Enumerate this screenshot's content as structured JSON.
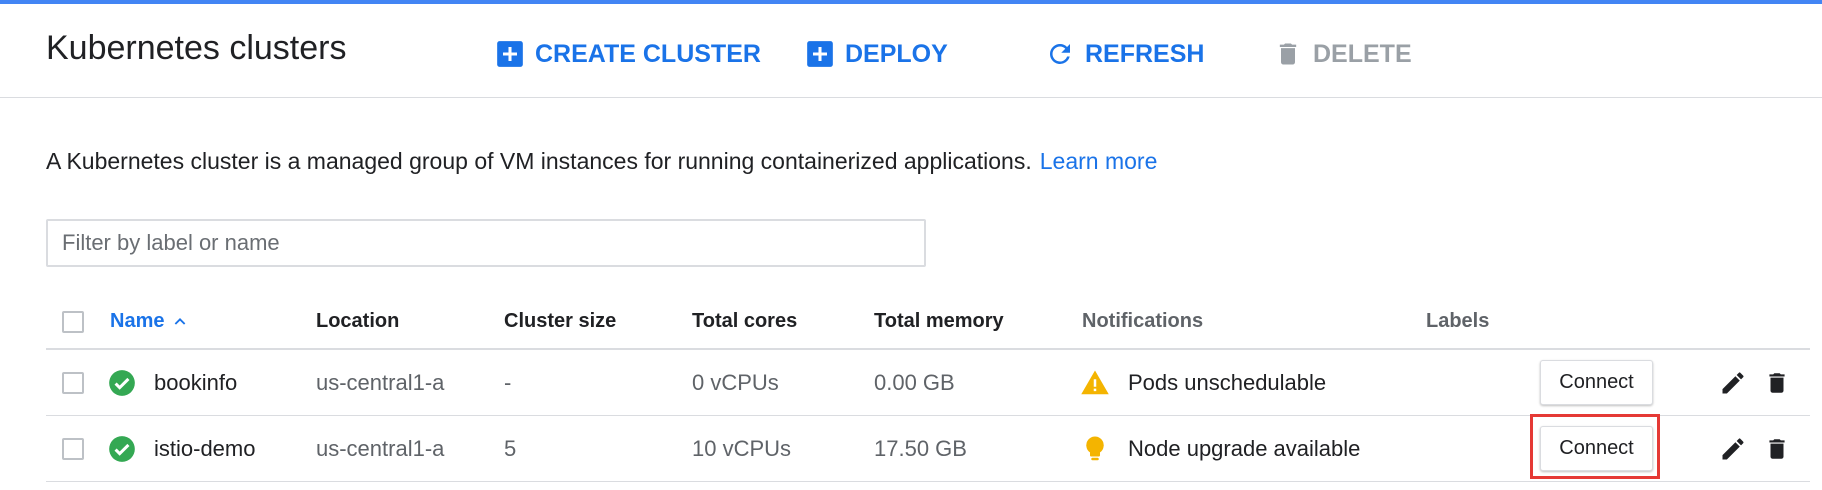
{
  "header": {
    "title": "Kubernetes clusters",
    "actions": {
      "create_cluster": "CREATE CLUSTER",
      "deploy": "DEPLOY",
      "refresh": "REFRESH",
      "delete": "DELETE"
    }
  },
  "description": {
    "text": "A Kubernetes cluster is a managed group of VM instances for running containerized applications.",
    "link": "Learn more"
  },
  "filter": {
    "placeholder": "Filter by label or name",
    "value": ""
  },
  "table": {
    "columns": {
      "name": "Name",
      "location": "Location",
      "cluster_size": "Cluster size",
      "total_cores": "Total cores",
      "total_memory": "Total memory",
      "notifications": "Notifications",
      "labels": "Labels"
    },
    "sort_icon": "sort-ascending-icon",
    "rows": [
      {
        "status_icon": "check-circle-icon",
        "name": "bookinfo",
        "location": "us-central1-a",
        "cluster_size": "-",
        "total_cores": "0 vCPUs",
        "total_memory": "0.00 GB",
        "notification_icon": "warning-icon",
        "notification": "Pods unschedulable",
        "labels": "",
        "connect": "Connect"
      },
      {
        "status_icon": "check-circle-icon",
        "name": "istio-demo",
        "location": "us-central1-a",
        "cluster_size": "5",
        "total_cores": "10 vCPUs",
        "total_memory": "17.50 GB",
        "notification_icon": "lightbulb-icon",
        "notification": "Node upgrade available",
        "labels": "",
        "connect": "Connect"
      }
    ]
  },
  "colors": {
    "accent": "#1a73e8",
    "success": "#34a853",
    "warning": "#f4b400",
    "disabled": "#9aa0a6",
    "highlight": "#e53935"
  }
}
